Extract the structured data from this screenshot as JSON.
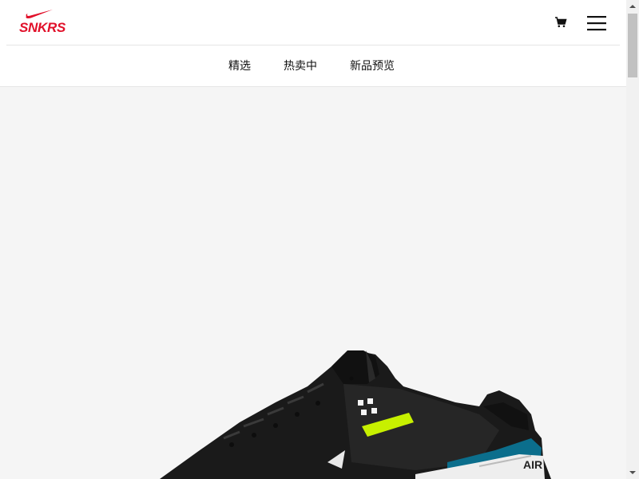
{
  "header": {
    "logo_text": "SNKRS",
    "cart_icon": "shopping-cart-icon",
    "menu_icon": "hamburger-menu-icon"
  },
  "nav": {
    "tabs": [
      {
        "label": "精选"
      },
      {
        "label": "热卖中"
      },
      {
        "label": "新品预览"
      }
    ]
  },
  "hero": {
    "image": "sneaker-product-image"
  },
  "colors": {
    "brand": "#e1102a",
    "hero_background": "#f5f5f5",
    "text": "#111111"
  }
}
